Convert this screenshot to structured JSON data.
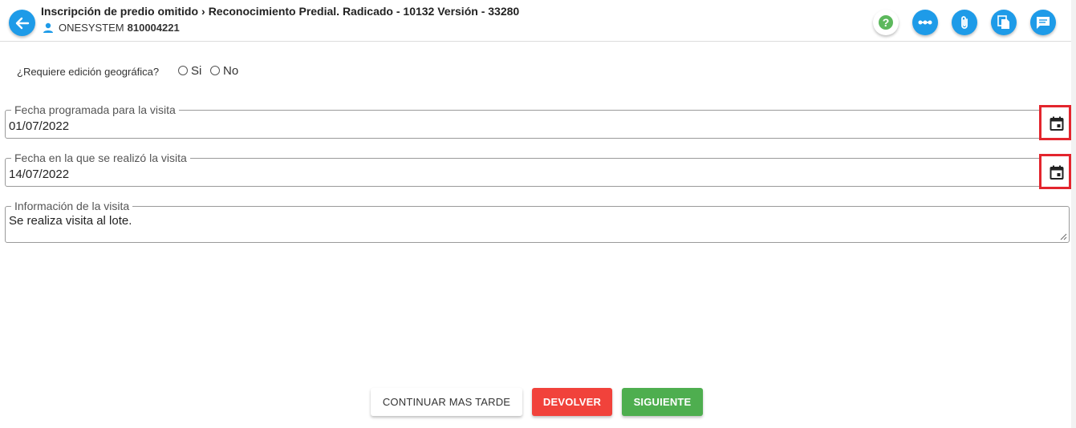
{
  "header": {
    "breadcrumb_parent": "Inscripción de predio omitido",
    "breadcrumb_current": "Reconocimiento Predial. Radicado - 10132 Versión - 33280",
    "user_name": "ONESYSTEM",
    "user_id": "810004221",
    "icons": [
      "help-icon",
      "workflow-icon",
      "attachment-icon",
      "documents-icon",
      "comments-icon"
    ]
  },
  "form": {
    "question": "¿Requiere edición geográfica?",
    "options": [
      "Si",
      "No"
    ],
    "visit_scheduled_label": "Fecha programada para la visita",
    "visit_scheduled_value": "01/07/2022",
    "visit_done_label": "Fecha en la que se realizó la visita",
    "visit_done_value": "14/07/2022",
    "visit_info_label": "Información de la visita",
    "visit_info_value": "Se realiza visita al lote."
  },
  "actions": {
    "later": "CONTINUAR MAS TARDE",
    "return": "DEVOLVER",
    "next": "SIGUIENTE"
  },
  "colors": {
    "primary": "#1e9be8",
    "danger": "#f1423b",
    "success": "#4eae4f",
    "highlight": "#e3252d",
    "help": "#5cb85c"
  }
}
